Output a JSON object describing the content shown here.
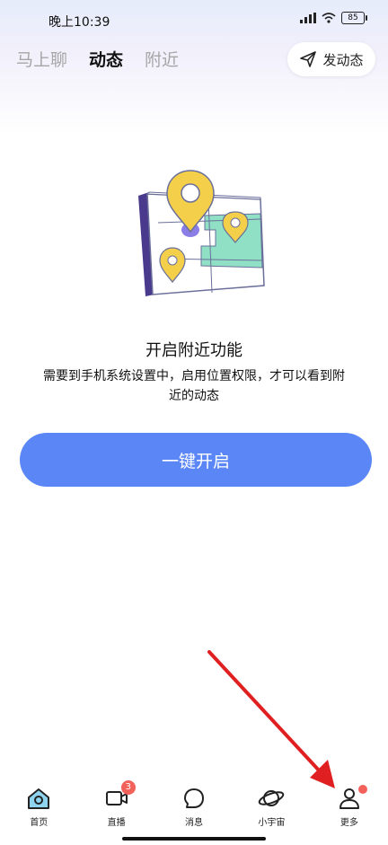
{
  "status_bar": {
    "time": "晚上10:39",
    "battery": "85"
  },
  "top_tabs": [
    {
      "label": "马上聊",
      "active": false
    },
    {
      "label": "动态",
      "active": true
    },
    {
      "label": "附近",
      "active": false
    }
  ],
  "post_button": {
    "label": "发动态",
    "icon": "send-icon"
  },
  "nearby_prompt": {
    "title": "开启附近功能",
    "description": "需要到手机系统设置中，启用位置权限，才可以看到附近的动态",
    "button": "一键开启"
  },
  "bottom_nav": [
    {
      "label": "首页",
      "icon": "home-icon",
      "active": true
    },
    {
      "label": "直播",
      "icon": "video-icon",
      "badge": "3"
    },
    {
      "label": "消息",
      "icon": "message-icon"
    },
    {
      "label": "小宇宙",
      "icon": "planet-icon"
    },
    {
      "label": "更多",
      "icon": "person-icon",
      "dot": true
    }
  ],
  "colors": {
    "accent": "#5b87f6",
    "badge": "#f2625b",
    "arrow": "#e02020"
  }
}
